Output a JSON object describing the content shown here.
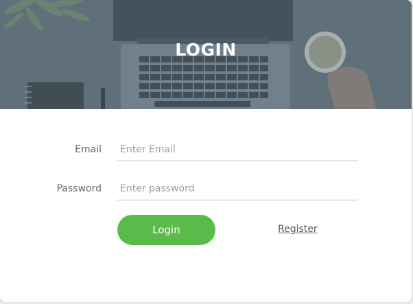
{
  "header": {
    "title": "LOGIN",
    "overlay_color": "#5f6f7a"
  },
  "form": {
    "email": {
      "label": "Email",
      "placeholder": "Enter Email",
      "value": ""
    },
    "password": {
      "label": "Password",
      "placeholder": "Enter password",
      "value": ""
    },
    "login_label": "Login",
    "register_label": "Register"
  },
  "colors": {
    "accent": "#5abb4a",
    "label": "#666a6e"
  }
}
